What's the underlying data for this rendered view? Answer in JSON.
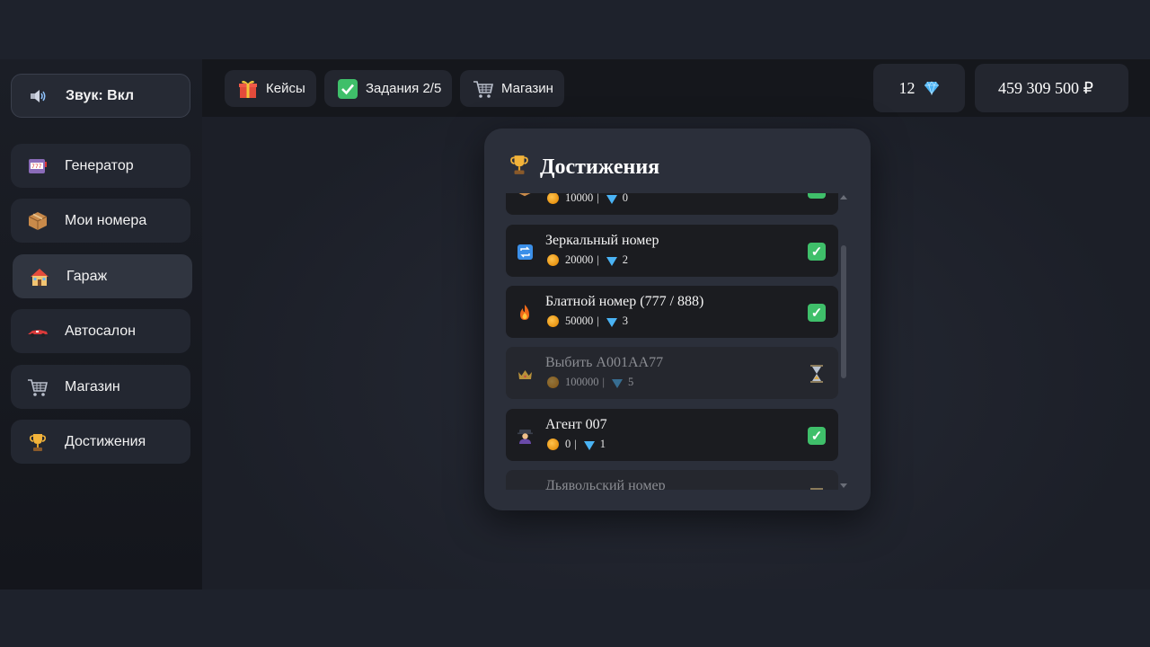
{
  "sidebar": {
    "sound_label": "Звук: Вкл",
    "items": [
      {
        "label": "Генератор",
        "icon": "slot-machine-icon"
      },
      {
        "label": "Мои номера",
        "icon": "package-icon"
      },
      {
        "label": "Гараж",
        "icon": "house-icon"
      },
      {
        "label": "Автосалон",
        "icon": "race-car-icon"
      },
      {
        "label": "Магазин",
        "icon": "shopping-cart-icon"
      },
      {
        "label": "Достижения",
        "icon": "trophy-icon"
      }
    ],
    "active_index": 2
  },
  "topbar": {
    "cases_label": "Кейсы",
    "tasks_label": "Задания 2/5",
    "shop_label": "Магазин",
    "gems": "12",
    "money": "459 309 500 ₽"
  },
  "modal": {
    "title": "Достижения",
    "achievements": [
      {
        "name": "",
        "coins": "10000",
        "gems": "0",
        "status": "done",
        "icon": "box-icon"
      },
      {
        "name": "Зеркальный номер",
        "coins": "20000",
        "gems": "2",
        "status": "done",
        "icon": "repeat-icon"
      },
      {
        "name": "Блатной номер (777 / 888)",
        "coins": "50000",
        "gems": "3",
        "status": "done",
        "icon": "fire-icon"
      },
      {
        "name": "Выбить А001АА77",
        "coins": "100000",
        "gems": "5",
        "status": "locked",
        "icon": "crown-icon"
      },
      {
        "name": "Агент 007",
        "coins": "0",
        "gems": "1",
        "status": "done",
        "icon": "detective-icon"
      },
      {
        "name": "Дьявольский номер",
        "coins": "",
        "gems": "",
        "status": "locked",
        "icon": "devil-icon"
      }
    ]
  },
  "colors": {
    "accent_check": "#3fbf6a",
    "gem": "#4ab3f4",
    "coin": "#e89412"
  }
}
